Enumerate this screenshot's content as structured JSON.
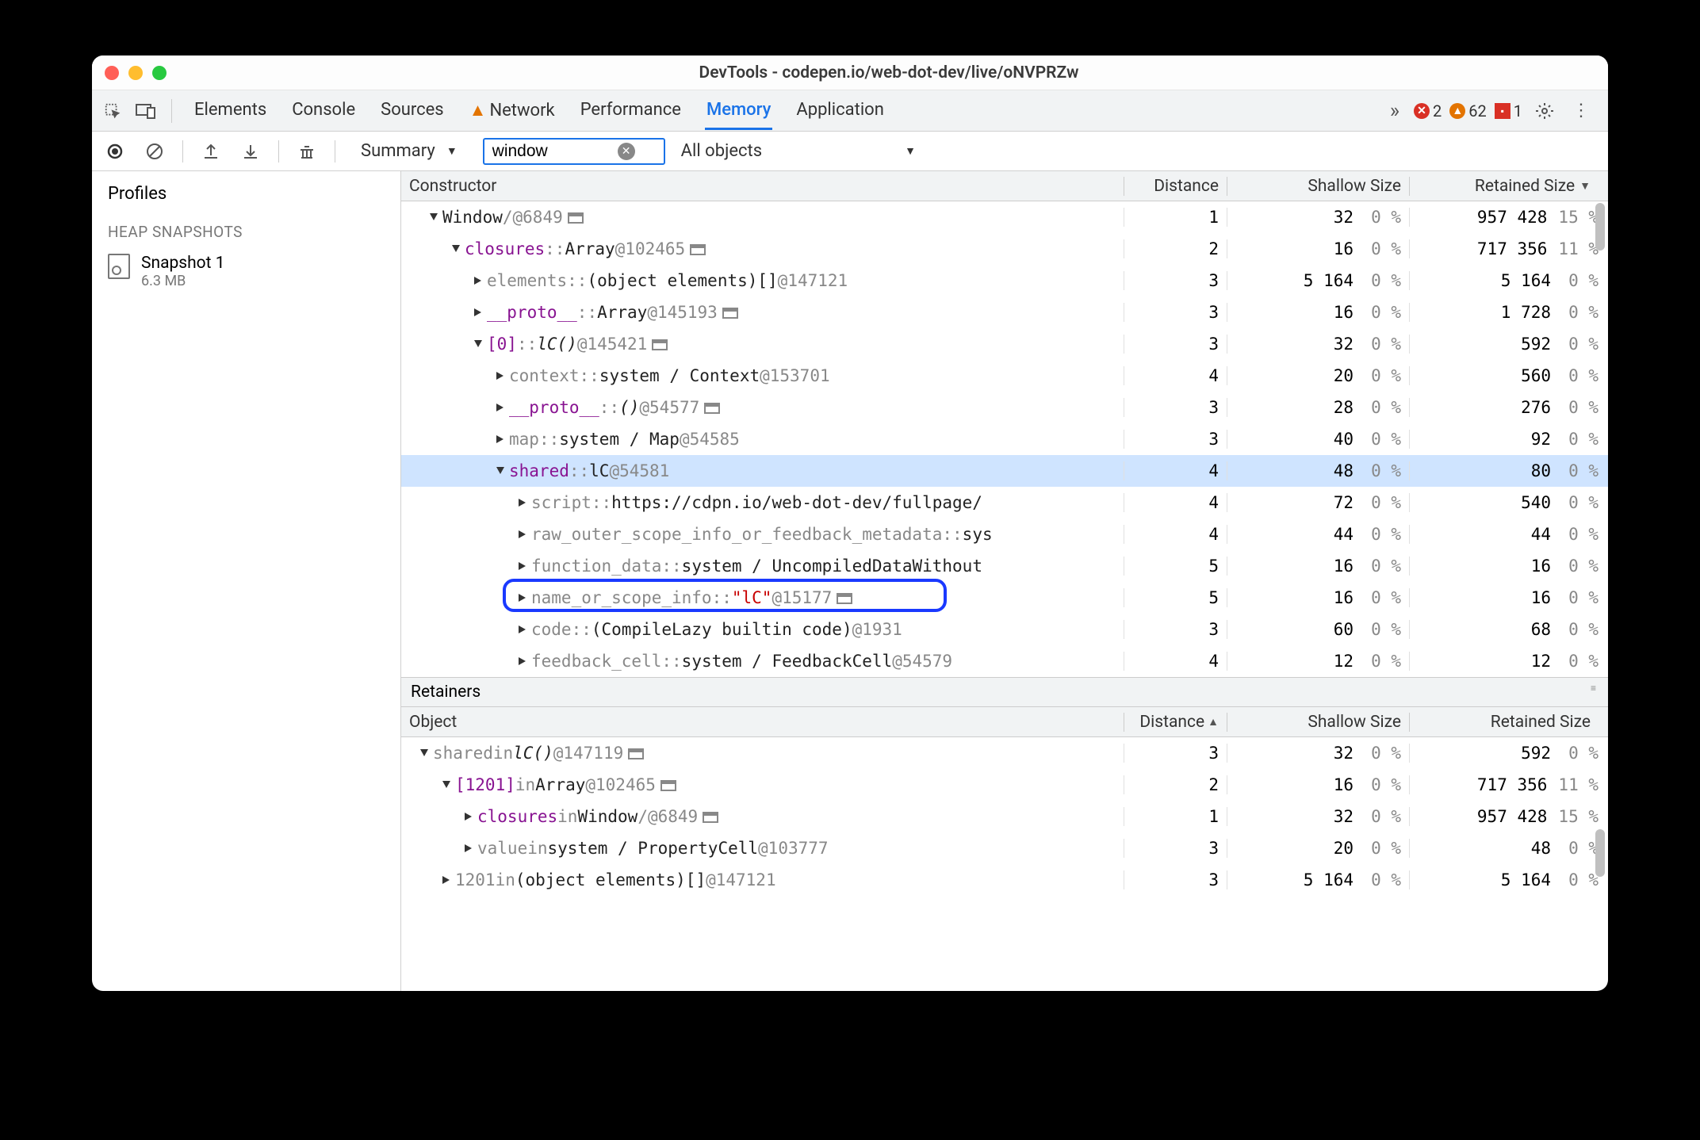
{
  "window": {
    "title": "DevTools - codepen.io/web-dot-dev/live/oNVPRZw"
  },
  "tabs": {
    "items": [
      "Elements",
      "Console",
      "Sources",
      "Network",
      "Performance",
      "Memory",
      "Application"
    ],
    "active": "Memory",
    "warn_tab": "Network"
  },
  "counts": {
    "errors": "2",
    "warnings": "62",
    "violations": "1"
  },
  "toolbar": {
    "summary_label": "Summary",
    "filter_value": "window",
    "scope_label": "All objects"
  },
  "sidebar": {
    "profiles": "Profiles",
    "heap_label": "HEAP SNAPSHOTS",
    "snapshot": {
      "name": "Snapshot 1",
      "size": "6.3 MB"
    }
  },
  "cols": {
    "c": "Constructor",
    "d": "Distance",
    "s": "Shallow Size",
    "r": "Retained Size"
  },
  "rows": [
    {
      "indent": 0,
      "open": true,
      "seg": [
        {
          "t": "Window",
          "c": "blk"
        },
        {
          "t": " / ",
          "c": "gray"
        },
        {
          "t": "  @6849",
          "c": "gray"
        },
        {
          "t": "",
          "icon": true
        }
      ],
      "d": "1",
      "sv": "32",
      "sp": "0 %",
      "rv": "957 428",
      "rp": "15 %"
    },
    {
      "indent": 1,
      "open": true,
      "seg": [
        {
          "t": "closures",
          "c": "purple"
        },
        {
          "t": " :: ",
          "c": "gray"
        },
        {
          "t": "Array",
          "c": "blk"
        },
        {
          "t": " @102465",
          "c": "gray"
        },
        {
          "t": "",
          "icon": true
        }
      ],
      "d": "2",
      "sv": "16",
      "sp": "0 %",
      "rv": "717 356",
      "rp": "11 %"
    },
    {
      "indent": 2,
      "open": false,
      "seg": [
        {
          "t": "elements",
          "c": "gray"
        },
        {
          "t": " :: ",
          "c": "gray"
        },
        {
          "t": "(object elements)[]",
          "c": "blk"
        },
        {
          "t": " @147121",
          "c": "gray"
        }
      ],
      "d": "3",
      "sv": "5 164",
      "sp": "0 %",
      "rv": "5 164",
      "rp": "0 %"
    },
    {
      "indent": 2,
      "open": false,
      "seg": [
        {
          "t": "__proto__",
          "c": "purple"
        },
        {
          "t": " :: ",
          "c": "gray"
        },
        {
          "t": "Array",
          "c": "blk"
        },
        {
          "t": " @145193",
          "c": "gray"
        },
        {
          "t": "",
          "icon": true
        }
      ],
      "d": "3",
      "sv": "16",
      "sp": "0 %",
      "rv": "1 728",
      "rp": "0 %"
    },
    {
      "indent": 2,
      "open": true,
      "seg": [
        {
          "t": "[0]",
          "c": "purple"
        },
        {
          "t": " :: ",
          "c": "gray"
        },
        {
          "t": "lC()",
          "c": "blk",
          "i": true
        },
        {
          "t": " @145421",
          "c": "gray"
        },
        {
          "t": "",
          "icon": true
        }
      ],
      "d": "3",
      "sv": "32",
      "sp": "0 %",
      "rv": "592",
      "rp": "0 %"
    },
    {
      "indent": 3,
      "open": false,
      "seg": [
        {
          "t": "context",
          "c": "gray"
        },
        {
          "t": " :: ",
          "c": "gray"
        },
        {
          "t": "system / Context",
          "c": "blk"
        },
        {
          "t": " @153701",
          "c": "gray"
        }
      ],
      "d": "4",
      "sv": "20",
      "sp": "0 %",
      "rv": "560",
      "rp": "0 %"
    },
    {
      "indent": 3,
      "open": false,
      "seg": [
        {
          "t": "__proto__",
          "c": "purple"
        },
        {
          "t": " :: ",
          "c": "gray"
        },
        {
          "t": "()",
          "c": "blk",
          "i": true
        },
        {
          "t": " @54577",
          "c": "gray"
        },
        {
          "t": "",
          "icon": true
        }
      ],
      "d": "3",
      "sv": "28",
      "sp": "0 %",
      "rv": "276",
      "rp": "0 %"
    },
    {
      "indent": 3,
      "open": false,
      "seg": [
        {
          "t": "map",
          "c": "gray"
        },
        {
          "t": " :: ",
          "c": "gray"
        },
        {
          "t": "system / Map",
          "c": "blk"
        },
        {
          "t": " @54585",
          "c": "gray"
        }
      ],
      "d": "3",
      "sv": "40",
      "sp": "0 %",
      "rv": "92",
      "rp": "0 %"
    },
    {
      "indent": 3,
      "open": true,
      "sel": true,
      "seg": [
        {
          "t": "shared",
          "c": "purple"
        },
        {
          "t": " :: ",
          "c": "gray"
        },
        {
          "t": "lC",
          "c": "blk"
        },
        {
          "t": " @54581",
          "c": "gray"
        }
      ],
      "d": "4",
      "sv": "48",
      "sp": "0 %",
      "rv": "80",
      "rp": "0 %"
    },
    {
      "indent": 4,
      "open": false,
      "seg": [
        {
          "t": "script",
          "c": "gray"
        },
        {
          "t": " :: ",
          "c": "gray"
        },
        {
          "t": "https://cdpn.io/web-dot-dev/fullpage/",
          "c": "blk"
        }
      ],
      "d": "4",
      "sv": "72",
      "sp": "0 %",
      "rv": "540",
      "rp": "0 %"
    },
    {
      "indent": 4,
      "open": false,
      "seg": [
        {
          "t": "raw_outer_scope_info_or_feedback_metadata",
          "c": "gray"
        },
        {
          "t": " :: ",
          "c": "gray"
        },
        {
          "t": "sys",
          "c": "blk"
        }
      ],
      "d": "4",
      "sv": "44",
      "sp": "0 %",
      "rv": "44",
      "rp": "0 %"
    },
    {
      "indent": 4,
      "open": false,
      "seg": [
        {
          "t": "function_data",
          "c": "gray"
        },
        {
          "t": " :: ",
          "c": "gray"
        },
        {
          "t": "system / UncompiledDataWithout",
          "c": "blk"
        }
      ],
      "d": "5",
      "sv": "16",
      "sp": "0 %",
      "rv": "16",
      "rp": "0 %"
    },
    {
      "indent": 4,
      "open": false,
      "ring": true,
      "seg": [
        {
          "t": "name_or_scope_info",
          "c": "gray"
        },
        {
          "t": " :: ",
          "c": "gray"
        },
        {
          "t": "\"lC\"",
          "c": "red"
        },
        {
          "t": " @15177",
          "c": "gray"
        },
        {
          "t": "",
          "icon": true
        }
      ],
      "d": "5",
      "sv": "16",
      "sp": "0 %",
      "rv": "16",
      "rp": "0 %"
    },
    {
      "indent": 4,
      "open": false,
      "seg": [
        {
          "t": "code",
          "c": "gray"
        },
        {
          "t": " :: ",
          "c": "gray"
        },
        {
          "t": "(CompileLazy builtin code)",
          "c": "blk"
        },
        {
          "t": " @1931",
          "c": "gray"
        }
      ],
      "d": "3",
      "sv": "60",
      "sp": "0 %",
      "rv": "68",
      "rp": "0 %"
    },
    {
      "indent": 4,
      "open": false,
      "seg": [
        {
          "t": "feedback_cell",
          "c": "gray"
        },
        {
          "t": " :: ",
          "c": "gray"
        },
        {
          "t": "system / FeedbackCell",
          "c": "blk"
        },
        {
          "t": " @54579",
          "c": "gray"
        }
      ],
      "d": "4",
      "sv": "12",
      "sp": "0 %",
      "rv": "12",
      "rp": "0 %"
    }
  ],
  "retainers_label": "Retainers",
  "rcols": {
    "o": "Object",
    "d": "Distance",
    "s": "Shallow Size",
    "r": "Retained Size"
  },
  "rrows": [
    {
      "indent": 0,
      "open": true,
      "seg": [
        {
          "t": "shared",
          "c": "gray"
        },
        {
          "t": " in ",
          "c": "gray"
        },
        {
          "t": "lC()",
          "c": "blk",
          "i": true
        },
        {
          "t": " @147119",
          "c": "gray"
        },
        {
          "t": "",
          "icon": true
        }
      ],
      "d": "3",
      "sv": "32",
      "sp": "0 %",
      "rv": "592",
      "rp": "0 %"
    },
    {
      "indent": 1,
      "open": true,
      "seg": [
        {
          "t": "[1201]",
          "c": "purple"
        },
        {
          "t": " in ",
          "c": "gray"
        },
        {
          "t": "Array",
          "c": "blk"
        },
        {
          "t": " @102465",
          "c": "gray"
        },
        {
          "t": "",
          "icon": true
        }
      ],
      "d": "2",
      "sv": "16",
      "sp": "0 %",
      "rv": "717 356",
      "rp": "11 %"
    },
    {
      "indent": 2,
      "open": false,
      "seg": [
        {
          "t": "closures",
          "c": "purple"
        },
        {
          "t": " in ",
          "c": "gray"
        },
        {
          "t": "Window",
          "c": "blk"
        },
        {
          "t": " / ",
          "c": "gray"
        },
        {
          "t": "  @6849",
          "c": "gray"
        },
        {
          "t": "",
          "icon": true
        }
      ],
      "d": "1",
      "sv": "32",
      "sp": "0 %",
      "rv": "957 428",
      "rp": "15 %"
    },
    {
      "indent": 2,
      "open": false,
      "seg": [
        {
          "t": "value",
          "c": "gray"
        },
        {
          "t": " in ",
          "c": "gray"
        },
        {
          "t": "system / PropertyCell",
          "c": "blk"
        },
        {
          "t": " @103777",
          "c": "gray"
        }
      ],
      "d": "3",
      "sv": "20",
      "sp": "0 %",
      "rv": "48",
      "rp": "0 %"
    },
    {
      "indent": 1,
      "open": false,
      "seg": [
        {
          "t": "1201",
          "c": "gray"
        },
        {
          "t": " in ",
          "c": "gray"
        },
        {
          "t": "(object elements)[]",
          "c": "blk"
        },
        {
          "t": " @147121",
          "c": "gray"
        }
      ],
      "d": "3",
      "sv": "5 164",
      "sp": "0 %",
      "rv": "5 164",
      "rp": "0 %"
    }
  ]
}
